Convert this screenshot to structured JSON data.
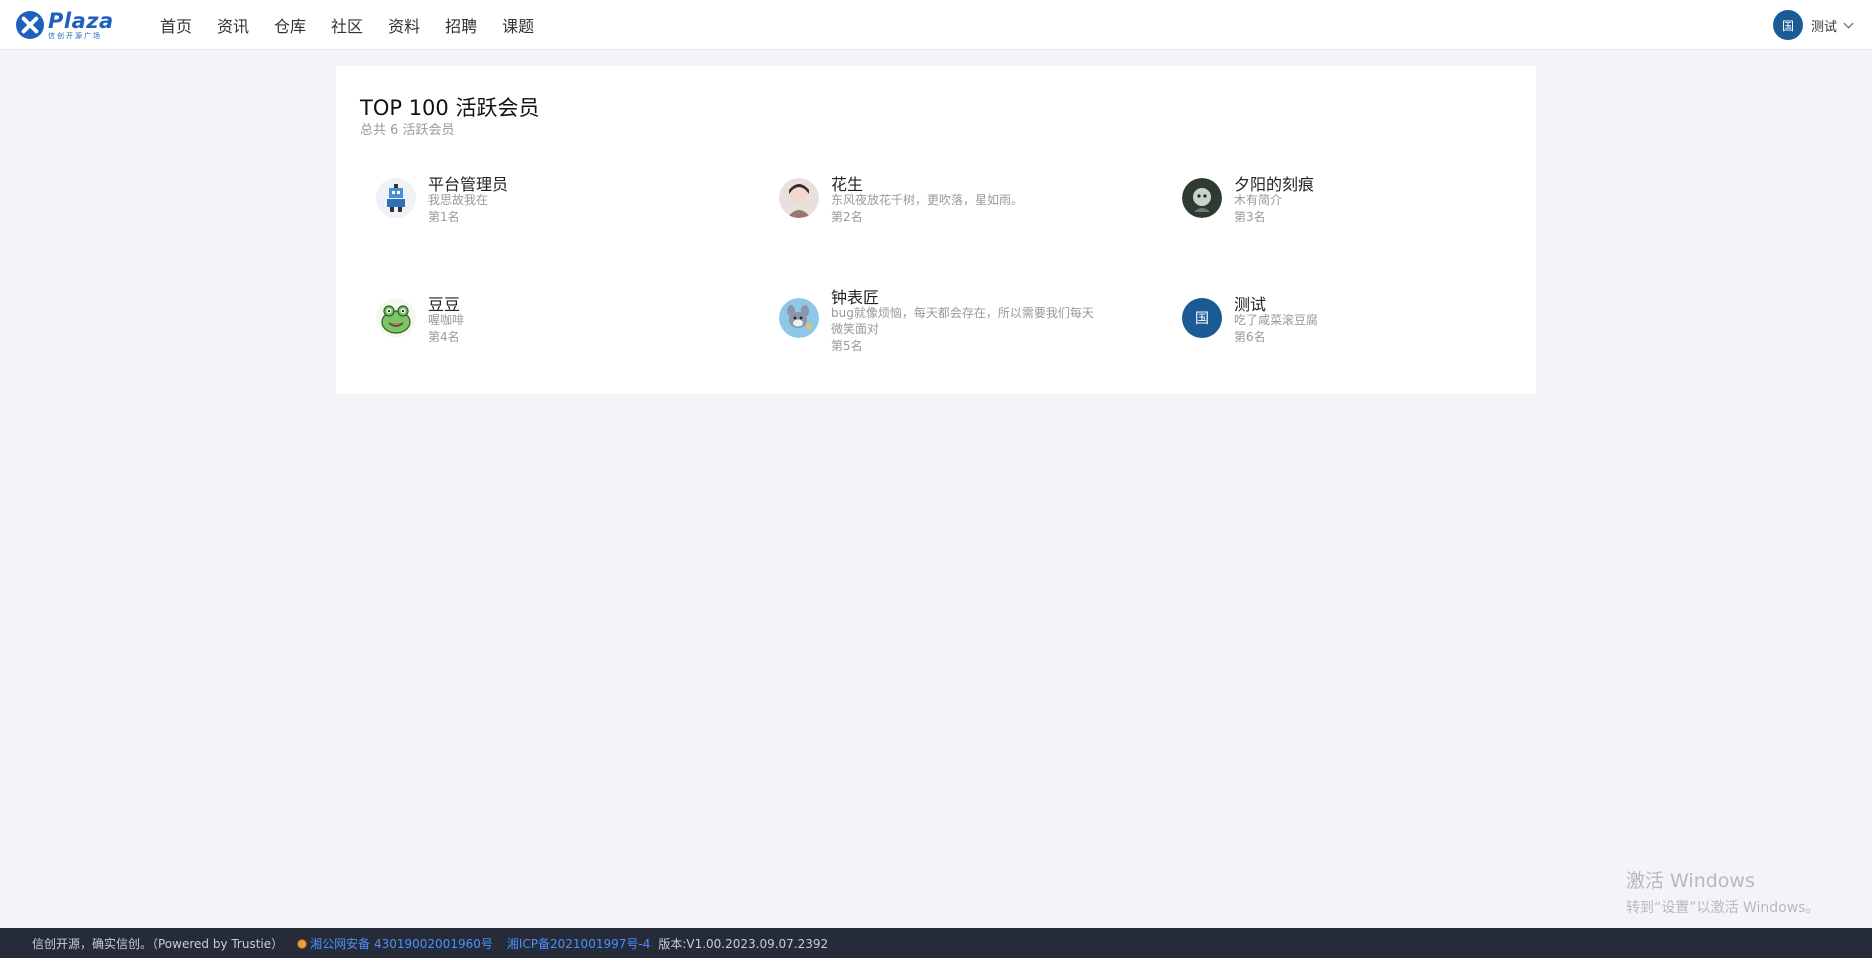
{
  "logo": {
    "word": "Plaza",
    "sub": "信创开源广场"
  },
  "nav": [
    "首页",
    "资讯",
    "仓库",
    "社区",
    "资料",
    "招聘",
    "课题"
  ],
  "user": {
    "avatar_text": "国",
    "name": "测试"
  },
  "panel": {
    "title": "TOP 100 活跃会员",
    "subtitle": "总共 6 活跃会员"
  },
  "members": [
    {
      "name": "平台管理员",
      "bio": "我思故我在",
      "rank": "第1名",
      "avatar": "robot-avatar"
    },
    {
      "name": "花生",
      "bio": "东风夜放花千树，更吹落，星如雨。",
      "rank": "第2名",
      "avatar": "portrait-avatar"
    },
    {
      "name": "夕阳的刻痕",
      "bio": "木有简介",
      "rank": "第3名",
      "avatar": "dark-avatar"
    },
    {
      "name": "豆豆",
      "bio": "喔咖啡",
      "rank": "第4名",
      "avatar": "frog-avatar"
    },
    {
      "name": "钟表匠",
      "bio": "bug就像烦恼，每天都会存在，所以需要我们每天微笑面对",
      "rank": "第5名",
      "avatar": "cartoon-avatar"
    },
    {
      "name": "测试",
      "bio": "吃了咸菜滚豆腐",
      "rank": "第6名",
      "avatar": "国"
    }
  ],
  "footer": {
    "slogan": "信创开源，确实信创。（Powered by Trustie）",
    "police": "湘公网安备 43019002001960号",
    "icp": "湘ICP备2021001997号-4",
    "version": "版本:V1.00.2023.09.07.2392"
  },
  "watermark": {
    "title": "激活 Windows",
    "sub": "转到“设置”以激活 Windows。"
  },
  "colors": {
    "brand": "#1f5fbf",
    "avatar_blue": "#1a5b96",
    "footer_bg": "#252b38",
    "link": "#4f8ef7"
  }
}
